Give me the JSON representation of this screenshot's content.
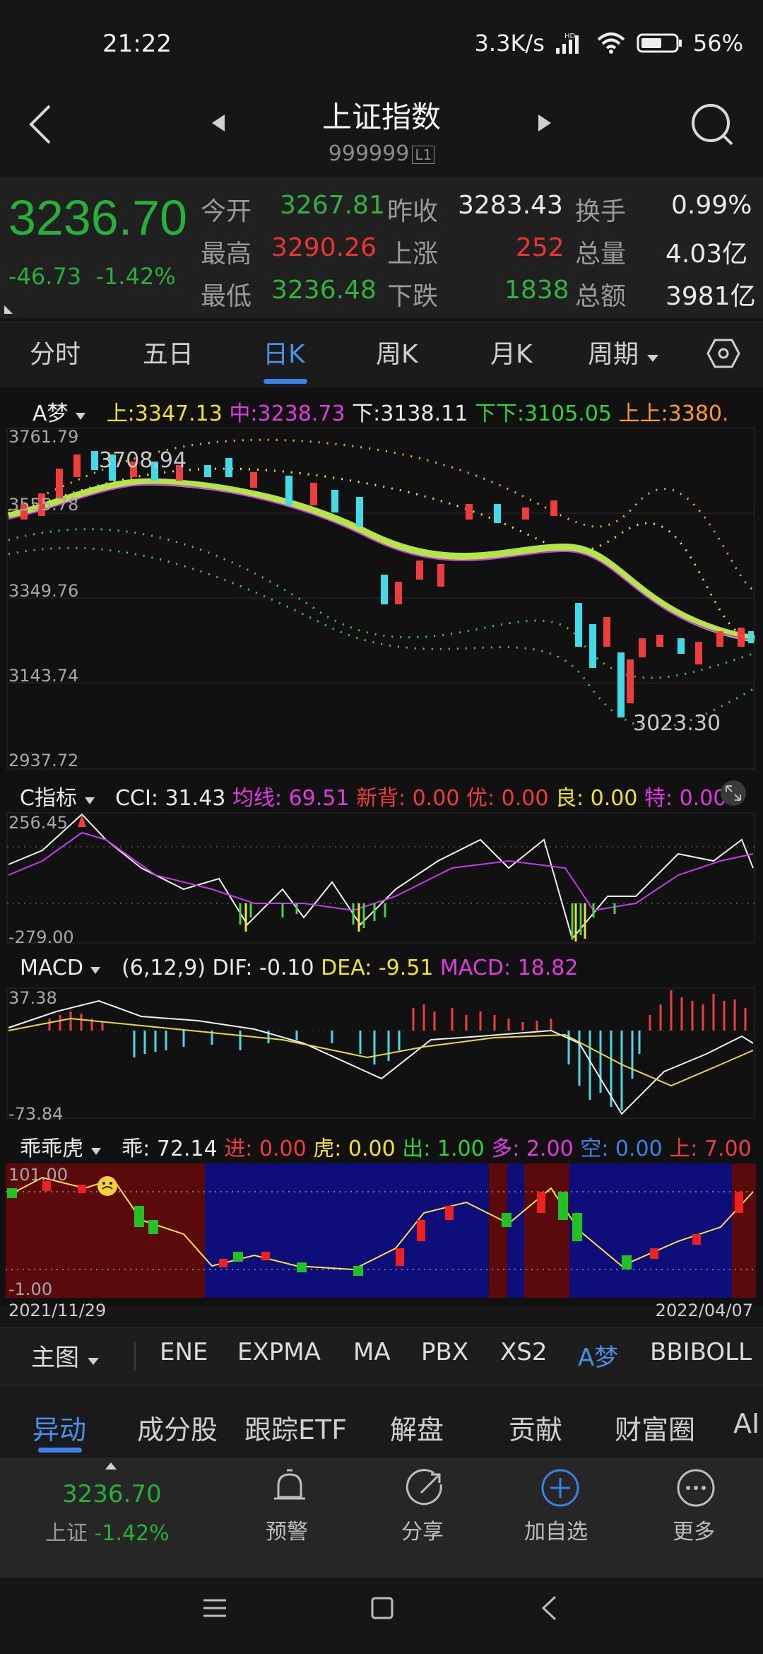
{
  "status": {
    "time": "21:22",
    "network_speed": "3.3K/s",
    "battery": "56%"
  },
  "header": {
    "title": "上证指数",
    "code": "999999",
    "level": "L1"
  },
  "quote": {
    "price": "3236.70",
    "change": "-46.73",
    "change_pct": "-1.42%",
    "rows": [
      {
        "l1": "今开",
        "v1": "3267.81",
        "l2": "昨收",
        "v2": "3283.43",
        "l3": "换手",
        "v3": "0.99%"
      },
      {
        "l1": "最高",
        "v1": "3290.26",
        "l2": "上涨",
        "v2": "252",
        "l3": "总量",
        "v3": "4.03亿"
      },
      {
        "l1": "最低",
        "v1": "3236.48",
        "l2": "下跌",
        "v2": "1838",
        "l3": "总额",
        "v3": "3981亿"
      }
    ]
  },
  "tabs": [
    "分时",
    "五日",
    "日K",
    "周K",
    "月K",
    "周期"
  ],
  "main_chart": {
    "indicator": "A梦",
    "up_label": "上:",
    "up_val": "3347.13",
    "mid_label": "中:",
    "mid_val": "3238.73",
    "down_label": "下:",
    "down_val": "3138.11",
    "down2_label": "下下:",
    "down2_val": "3105.05",
    "up2_label": "上上:",
    "up2_val": "3380.",
    "y_ticks": [
      "3761.79",
      "3555.78",
      "3349.76",
      "3143.74",
      "2937.72"
    ],
    "high_note": "3708.94",
    "low_note": "3023.30"
  },
  "cci": {
    "name": "C指标",
    "l1": "CCI: 31.43",
    "l2": "均线: 69.51",
    "l3": "新背: 0.00",
    "l4": "优: 0.00",
    "l5": "良: 0.00",
    "l6": "特: 0.00",
    "ymax": "256.45",
    "ymin": "-279.00"
  },
  "macd": {
    "name": "MACD",
    "params": "(6,12,9)",
    "dif": "DIF: -0.10",
    "dea": "DEA: -9.51",
    "macd": "MACD: 18.82",
    "ymax": "37.38",
    "ymin": "-73.84"
  },
  "gg": {
    "name": "乖乖虎",
    "l1": "乖: 72.14",
    "l2": "进: 0.00",
    "l3": "虎: 0.00",
    "l4": "出: 1.00",
    "l5": "多: 2.00",
    "l6": "空: 0.00",
    "l7": "上: 7.00",
    "ymax": "101.00",
    "ymin": "-1.00",
    "date_start": "2021/11/29",
    "date_end": "2022/04/07"
  },
  "main_tabs": [
    "主图",
    "ENE",
    "EXPMA",
    "MA",
    "PBX",
    "XS2",
    "A梦",
    "BBIBOLL"
  ],
  "bottom_tabs": [
    "异动",
    "成分股",
    "跟踪ETF",
    "解盘",
    "贡献",
    "财富圈",
    "AI"
  ],
  "footer": {
    "price": "3236.70",
    "name": "上证",
    "pct": "-1.42%",
    "actions": [
      "预警",
      "分享",
      "加自选",
      "更多"
    ]
  }
}
